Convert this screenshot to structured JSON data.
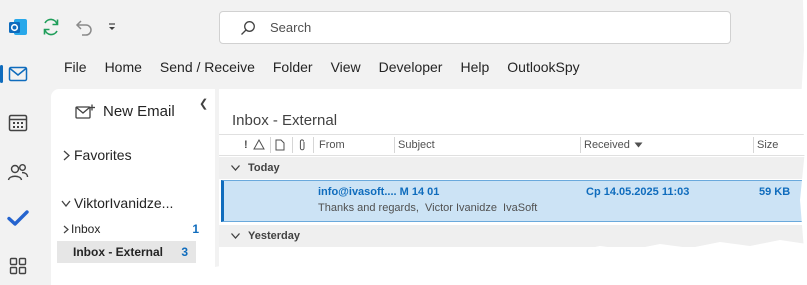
{
  "rail": {
    "items": [
      {
        "icon": "outlook-logo-icon"
      },
      {
        "icon": "mail-icon",
        "active": true
      },
      {
        "icon": "calendar-icon"
      },
      {
        "icon": "people-icon"
      },
      {
        "icon": "todo-check-icon"
      },
      {
        "icon": "apps-icon"
      }
    ]
  },
  "quick_access": {
    "icons": [
      "sync-icon",
      "undo-icon",
      "customize-dropdown-icon"
    ]
  },
  "search": {
    "placeholder": "Search"
  },
  "menu": {
    "items": [
      "File",
      "Home",
      "Send / Receive",
      "Folder",
      "View",
      "Developer",
      "Help",
      "OutlookSpy"
    ]
  },
  "folder_pane": {
    "new_email_label": "New Email",
    "favorites_label": "Favorites",
    "account_label": "ViktorIvanidze...",
    "folders": [
      {
        "name": "Inbox",
        "count": "1",
        "selected": false
      },
      {
        "name": "Inbox - External",
        "count": "3",
        "selected": true
      }
    ]
  },
  "message_list": {
    "title": "Inbox - External",
    "columns": {
      "importance": "!",
      "from": "From",
      "subject": "Subject",
      "received": "Received",
      "size": "Size"
    },
    "groups": [
      {
        "label": "Today",
        "messages": [
          {
            "from": "info@ivasoft.... M 14 01",
            "received": "Ср 14.05.2025 11:03",
            "size": "59 KB",
            "preview": "Thanks and regards,  Victor Ivanidze  IvaSoft",
            "selected": true,
            "unread": true
          }
        ]
      },
      {
        "label": "Yesterday",
        "messages": []
      }
    ]
  },
  "colors": {
    "accent": "#0f6cbd",
    "selected_row": "#cce3f5",
    "background": "#f2f2f2",
    "sync_green": "#1f9e5a"
  }
}
